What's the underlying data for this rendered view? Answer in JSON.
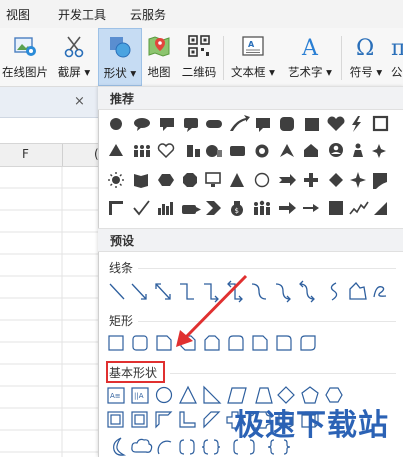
{
  "menubar": {
    "items": [
      "视图",
      "开发工具",
      "云服务"
    ]
  },
  "ribbon": {
    "buttons": [
      {
        "label": "在线图片",
        "icon": "online-picture-icon"
      },
      {
        "label": "截屏 ▾",
        "icon": "screenshot-icon"
      },
      {
        "label": "形状 ▾",
        "icon": "shapes-icon"
      },
      {
        "label": "地图",
        "icon": "map-icon"
      },
      {
        "label": "二维码",
        "icon": "qr-code-icon"
      },
      {
        "label": "文本框 ▾",
        "icon": "textbox-icon"
      },
      {
        "label": "艺术字 ▾",
        "icon": "wordart-icon"
      },
      {
        "label": "符号 ▾",
        "icon": "symbol-icon"
      },
      {
        "label": "公",
        "icon": "formula-icon"
      }
    ],
    "active": "形状 ▾"
  },
  "sheet": {
    "tab_close": "×",
    "column": "F",
    "column_next": "("
  },
  "panel": {
    "recommended_title": "推荐",
    "preset_title": "预设",
    "lines_title": "线条",
    "rect_title": "矩形",
    "basic_title": "基本形状"
  },
  "colors": {
    "accent": "#1f6fb5",
    "shape_fill": "#3f3f3f",
    "shape_outline": "#2e5f9e",
    "arrow": "#e03030"
  },
  "watermark": "极速下载站"
}
